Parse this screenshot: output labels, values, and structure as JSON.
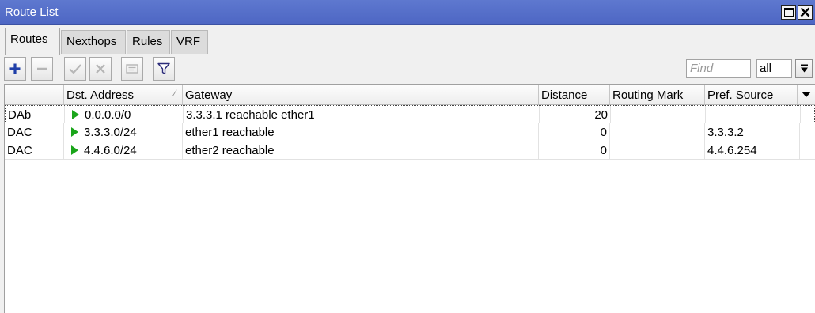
{
  "window": {
    "title": "Route List"
  },
  "tabs": [
    {
      "label": "Routes",
      "active": true
    },
    {
      "label": "Nexthops",
      "active": false
    },
    {
      "label": "Rules",
      "active": false
    },
    {
      "label": "VRF",
      "active": false
    }
  ],
  "toolbar": {
    "buttons": [
      {
        "icon": "plus-icon",
        "enabled": true
      },
      {
        "icon": "minus-icon",
        "enabled": false
      },
      {
        "icon": "check-icon",
        "enabled": false
      },
      {
        "icon": "x-icon",
        "enabled": false
      },
      {
        "icon": "comment-icon",
        "enabled": false
      },
      {
        "icon": "filter-icon",
        "enabled": true
      }
    ],
    "find_placeholder": "Find",
    "filter_value": "all"
  },
  "table": {
    "columns": [
      "",
      "Dst. Address",
      "Gateway",
      "Distance",
      "Routing Mark",
      "Pref. Source"
    ],
    "sort_column": "Dst. Address",
    "rows": [
      {
        "flags": "DAb",
        "dst": "0.0.0.0/0",
        "gateway": "3.3.3.1 reachable ether1",
        "distance": "20",
        "routing_mark": "",
        "pref_source": ""
      },
      {
        "flags": "DAC",
        "dst": "3.3.3.0/24",
        "gateway": "ether1 reachable",
        "distance": "0",
        "routing_mark": "",
        "pref_source": "3.3.3.2"
      },
      {
        "flags": "DAC",
        "dst": "4.4.6.0/24",
        "gateway": "ether2 reachable",
        "distance": "0",
        "routing_mark": "",
        "pref_source": "4.4.6.254"
      }
    ]
  },
  "colors": {
    "titlebar": "#5470cb",
    "add_icon": "#1f3fa8",
    "active_route_arrow": "#1aa51a"
  }
}
